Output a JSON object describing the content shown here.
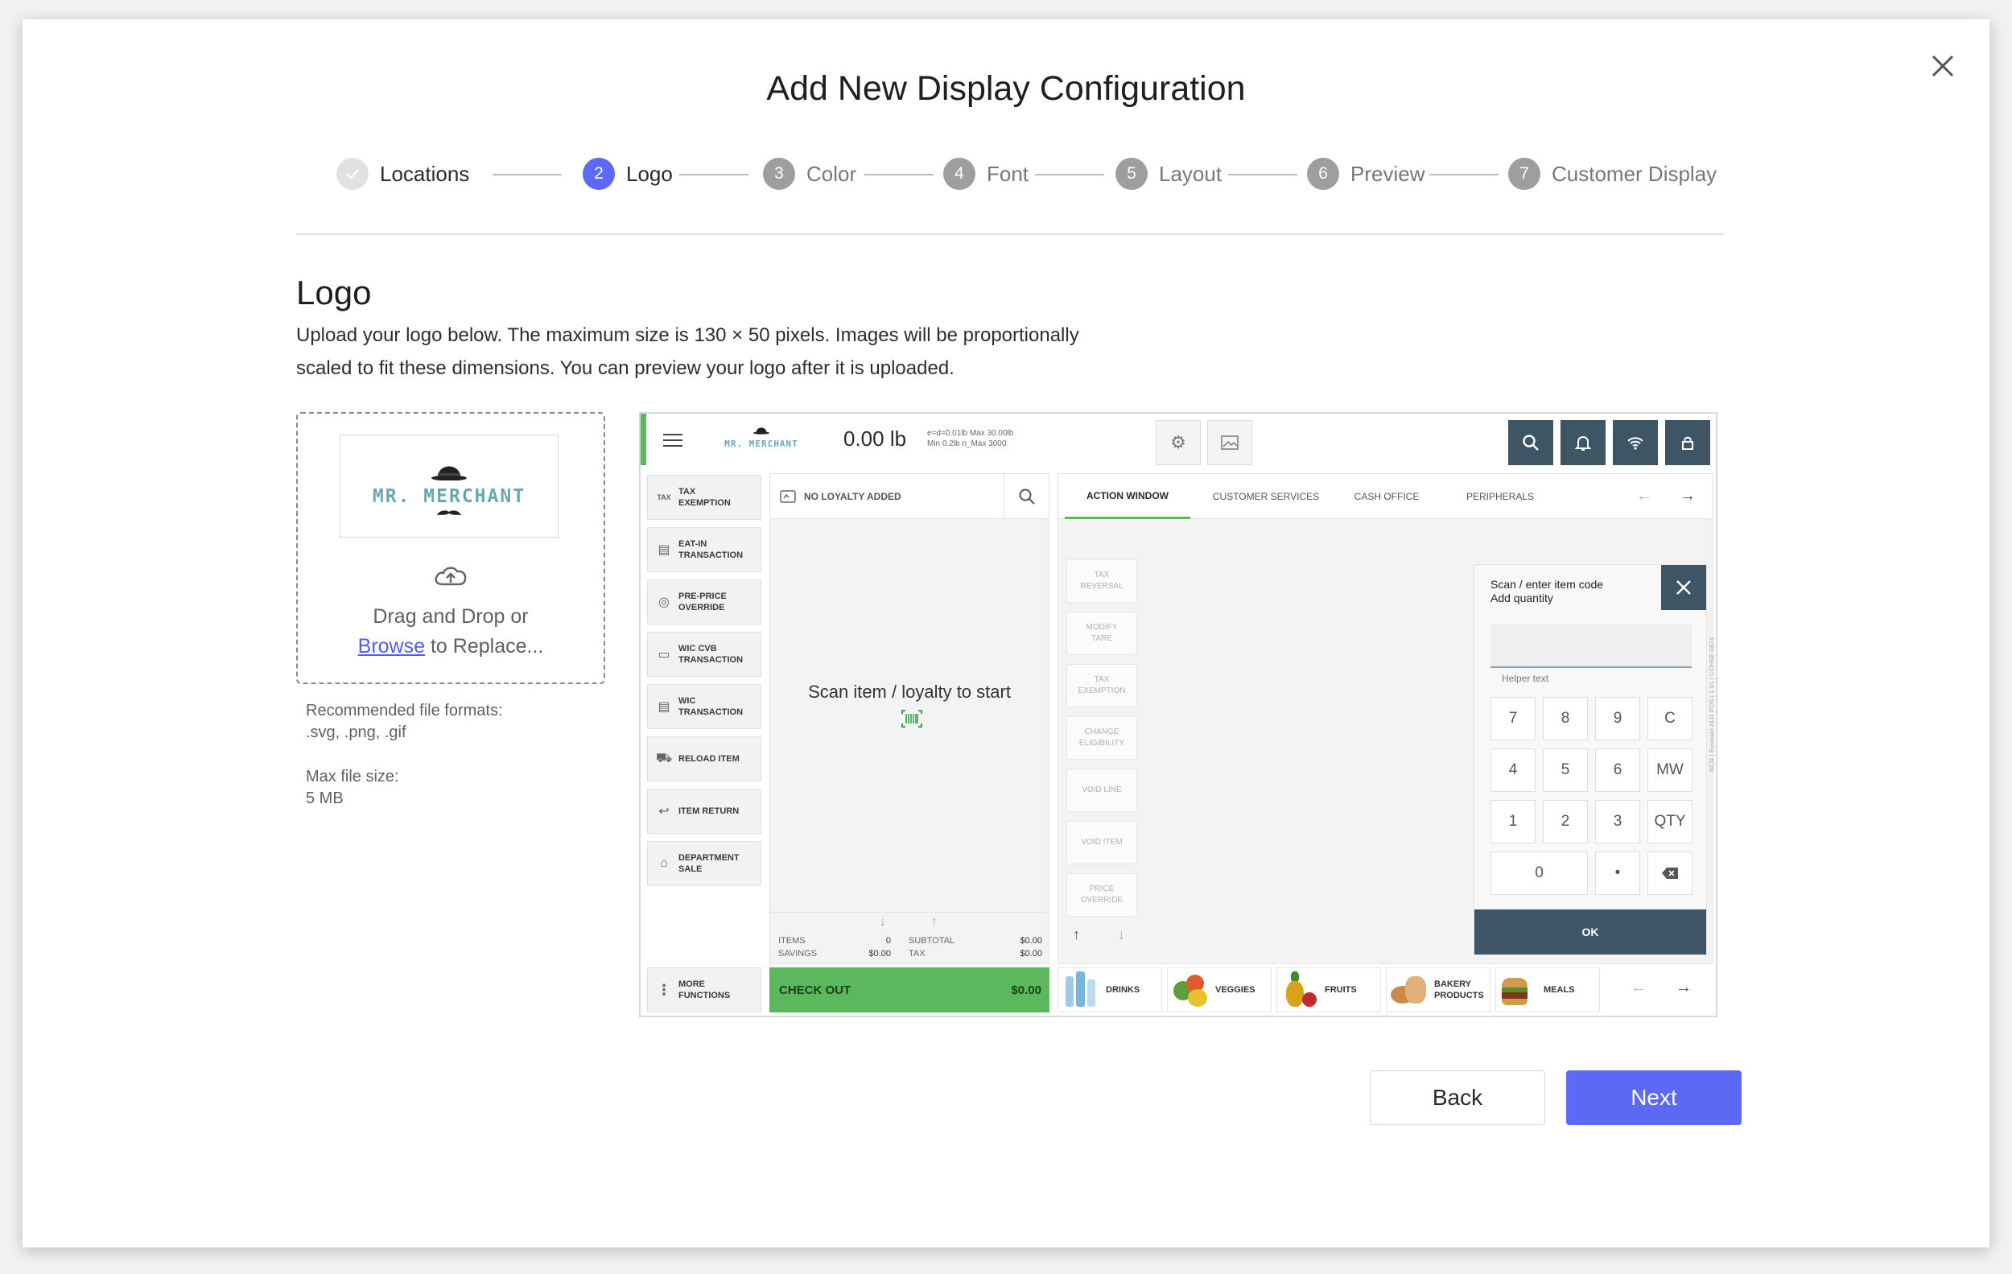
{
  "dialog": {
    "title": "Add New Display Configuration"
  },
  "steps": [
    {
      "num": "",
      "label": "Locations",
      "state": "done"
    },
    {
      "num": "2",
      "label": "Logo",
      "state": "active"
    },
    {
      "num": "3",
      "label": "Color",
      "state": "pending"
    },
    {
      "num": "4",
      "label": "Font",
      "state": "pending"
    },
    {
      "num": "5",
      "label": "Layout",
      "state": "pending"
    },
    {
      "num": "6",
      "label": "Preview",
      "state": "pending"
    },
    {
      "num": "7",
      "label": "Customer Display",
      "state": "pending"
    }
  ],
  "section": {
    "title": "Logo",
    "description_line1": "Upload your logo below. The maximum size is 130 × 50 pixels. Images will be proportionally",
    "description_line2": "scaled to fit these dimensions. You can preview your logo after it is uploaded."
  },
  "dropzone": {
    "logo_text": "MR. MERCHANT",
    "drag_text": "Drag and Drop or",
    "browse_link": "Browse",
    "replace_text": " to Replace..."
  },
  "hints": {
    "formats_label": "Recommended file formats:",
    "formats_value": ".svg, .png, .gif",
    "size_label": "Max file size:",
    "size_value": "5 MB"
  },
  "pos_preview": {
    "logo_text": "MR. MERCHANT",
    "weight": "0.00 lb",
    "scale_info_1": "e=d=0.01lb Max 30.00lb",
    "scale_info_2": "Min 0.2lb n_Max 3000",
    "sidebar": [
      {
        "icon": "tax-icon",
        "glyph": "TAX",
        "label1": "TAX",
        "label2": "EXEMPTION"
      },
      {
        "icon": "receipt-icon",
        "glyph": "▤",
        "label1": "EAT-IN",
        "label2": "TRANSACTION"
      },
      {
        "icon": "price-icon",
        "glyph": "◎",
        "label1": "PRE-PRICE",
        "label2": "OVERRIDE"
      },
      {
        "icon": "card-icon",
        "glyph": "▭",
        "label1": "WIC CVB",
        "label2": "TRANSACTION"
      },
      {
        "icon": "receipt-icon",
        "glyph": "▤",
        "label1": "WIC",
        "label2": "TRANSACTION"
      },
      {
        "icon": "cart-icon",
        "glyph": "⛟",
        "label1": "RELOAD ITEM",
        "label2": ""
      },
      {
        "icon": "return-icon",
        "glyph": "↩",
        "label1": "ITEM RETURN",
        "label2": ""
      },
      {
        "icon": "department-icon",
        "glyph": "⌂",
        "label1": "DEPARTMENT",
        "label2": "SALE"
      }
    ],
    "more_functions_1": "MORE",
    "more_functions_2": "FUNCTIONS",
    "loyalty": "NO LOYALTY ADDED",
    "scan_prompt": "Scan item / loyalty to start",
    "totals": {
      "items_label": "ITEMS",
      "items_value": "0",
      "savings_label": "SAVINGS",
      "savings_value": "$0.00",
      "subtotal_label": "SUBTOTAL",
      "subtotal_value": "$0.00",
      "tax_label": "TAX",
      "tax_value": "$0.00"
    },
    "checkout_label": "CHECK OUT",
    "checkout_total": "$0.00",
    "tabs": [
      "ACTION WINDOW",
      "CUSTOMER SERVICES",
      "CASH OFFICE",
      "PERIPHERALS"
    ],
    "actions": [
      {
        "l1": "TAX",
        "l2": "REVERSAL"
      },
      {
        "l1": "MODIFY",
        "l2": "TARE"
      },
      {
        "l1": "TAX",
        "l2": "EXEMPTION"
      },
      {
        "l1": "CHANGE",
        "l2": "ELIGIBILITY"
      },
      {
        "l1": "VOID LINE",
        "l2": ""
      },
      {
        "l1": "VOID ITEM",
        "l2": ""
      },
      {
        "l1": "PRICE",
        "l2": "OVERRIDE"
      }
    ],
    "keypad": {
      "title1": "Scan / enter item code",
      "title2": "Add quantity",
      "helper": "Helper text",
      "keys": [
        "7",
        "8",
        "9",
        "C",
        "4",
        "5",
        "6",
        "MW",
        "1",
        "2",
        "3",
        "QTY"
      ],
      "zero": "0",
      "dot": "•",
      "ok": "OK"
    },
    "side_text": "NCR | Emerald XLR POS | 1.01 | CCHSE 0874",
    "categories": [
      {
        "name1": "DRINKS",
        "name2": "",
        "color": "#7ab4d8"
      },
      {
        "name1": "VEGGIES",
        "name2": "",
        "color": "#5e9e3a"
      },
      {
        "name1": "FRUITS",
        "name2": "",
        "color": "#d9a21b"
      },
      {
        "name1": "BAKERY",
        "name2": "PRODUCTS",
        "color": "#c98a4a"
      },
      {
        "name1": "MEALS",
        "name2": "",
        "color": "#b8763a"
      }
    ]
  },
  "buttons": {
    "back": "Back",
    "next": "Next"
  },
  "colors": {
    "accent": "#5b69f5",
    "pos_dark": "#3d5564",
    "pos_green": "#5cb85c"
  }
}
